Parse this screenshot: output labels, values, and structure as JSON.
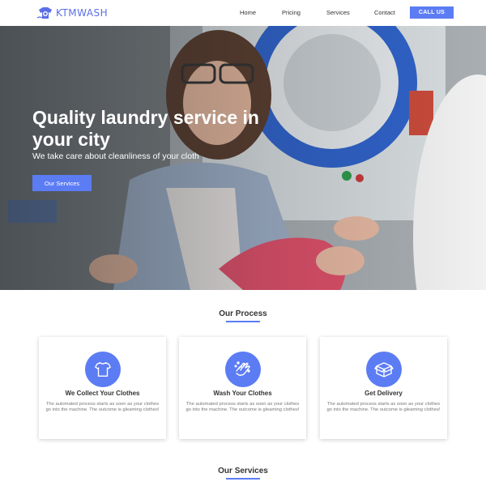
{
  "brand": {
    "name": "KTMWASH"
  },
  "nav": {
    "items": [
      {
        "label": "Home"
      },
      {
        "label": "Pricing"
      },
      {
        "label": "Services"
      },
      {
        "label": "Contact"
      }
    ],
    "cta_label": "CALL US"
  },
  "hero": {
    "title": "Quality laundry service in your city",
    "subtitle": "We take care about cleanliness of your cloth",
    "button_label": "Our Services"
  },
  "process": {
    "title": "Our Process",
    "cards": [
      {
        "icon": "tshirt-icon",
        "title": "We Collect Your Clothes",
        "text": "The automated process starts as soon as your clothes go into the machine. The outcome is gleaming clothes!"
      },
      {
        "icon": "hand-wash-icon",
        "title": "Wash Your Clothes",
        "text": "The automated process starts as soon as your clothes go into the machine. The outcome is gleaming clothes!"
      },
      {
        "icon": "box-icon",
        "title": "Get Delivery",
        "text": "The automated process starts as soon as your clothes go into the machine. The outcome is gleaming clothes!"
      }
    ]
  },
  "services": {
    "title": "Our Services"
  },
  "colors": {
    "accent": "#5c7cf4",
    "text": "#333333",
    "muted": "#777777"
  }
}
